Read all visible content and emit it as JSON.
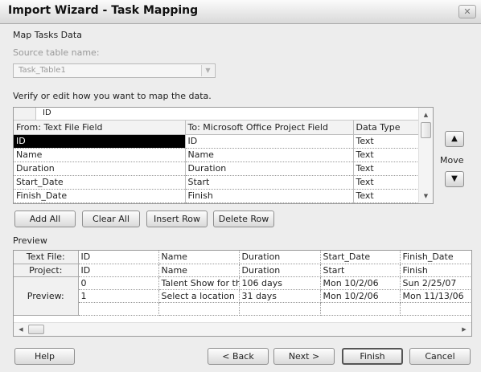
{
  "window": {
    "title": "Import Wizard - Task Mapping"
  },
  "icons": {
    "close": "close-icon",
    "up": "move-up-icon",
    "down": "move-down-icon"
  },
  "section": {
    "map_heading": "Map Tasks Data",
    "source_label": "Source table name:",
    "source_value": "Task_Table1",
    "verify_text": "Verify or edit how you want to map the data."
  },
  "mapping": {
    "edit_value": "ID",
    "headers": [
      "From: Text File Field",
      "To: Microsoft Office Project Field",
      "Data Type"
    ],
    "rows": [
      [
        "ID",
        "ID",
        "Text"
      ],
      [
        "Name",
        "Name",
        "Text"
      ],
      [
        "Duration",
        "Duration",
        "Text"
      ],
      [
        "Start_Date",
        "Start",
        "Text"
      ],
      [
        "Finish_Date",
        "Finish",
        "Text"
      ]
    ],
    "selected_row": 0
  },
  "move": {
    "label": "Move"
  },
  "row_buttons": {
    "add_all": "Add All",
    "clear_all": "Clear All",
    "insert_row": "Insert Row",
    "delete_row": "Delete Row"
  },
  "preview": {
    "label": "Preview",
    "row_labels": [
      "Text File:",
      "Project:",
      "Preview:"
    ],
    "text_file": [
      "ID",
      "Name",
      "Duration",
      "Start_Date",
      "Finish_Date"
    ],
    "project": [
      "ID",
      "Name",
      "Duration",
      "Start",
      "Finish"
    ],
    "data": [
      [
        "0",
        "Talent Show for th",
        "106 days",
        "Mon 10/2/06",
        "Sun 2/25/07"
      ],
      [
        "1",
        "Select a location",
        "31 days",
        "Mon 10/2/06",
        "Mon 11/13/06"
      ]
    ]
  },
  "footer": {
    "help": "Help",
    "back": "< Back",
    "next": "Next >",
    "finish": "Finish",
    "cancel": "Cancel"
  }
}
